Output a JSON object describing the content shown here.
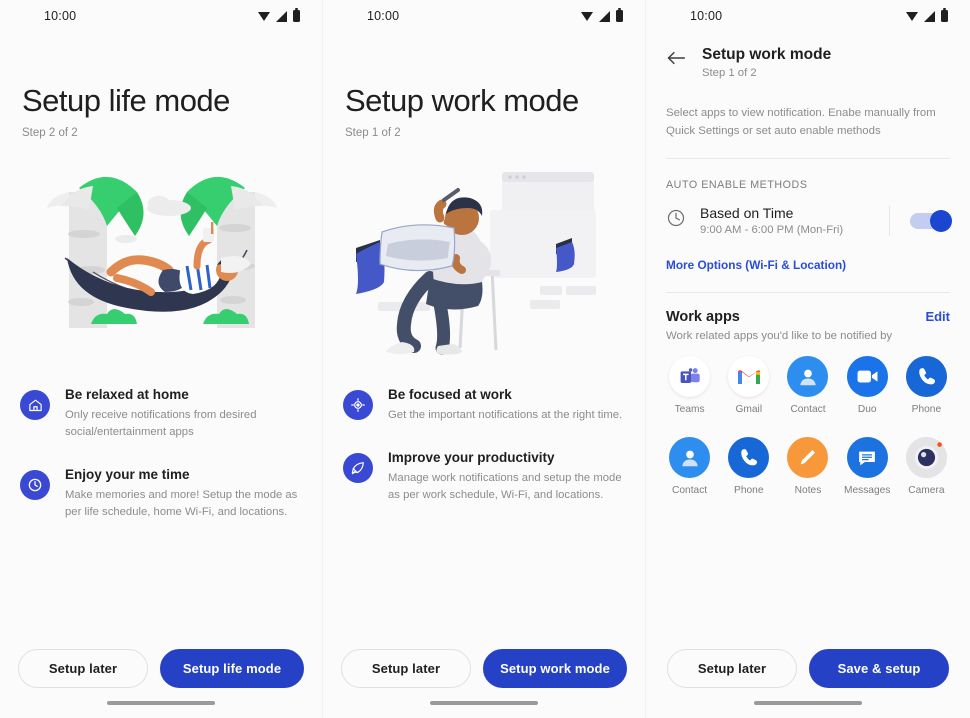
{
  "statusbar": {
    "time": "10:00",
    "icons": [
      "wifi-icon",
      "signal-icon",
      "battery-icon"
    ]
  },
  "colors": {
    "primary": "#2541c6",
    "badge": "#3949d4",
    "link": "#2a4cd7",
    "toggle_on": "#1a46d0",
    "background": "#fbfbfb",
    "text": "#1f1f1f",
    "muted": "#8c8c8c"
  },
  "panel_life": {
    "title": "Setup life mode",
    "step": "Step 2 of 2",
    "illustration": "hammock-relax-illustration",
    "features": [
      {
        "icon": "home-icon",
        "title": "Be relaxed at home",
        "desc": "Only receive notifications from desired social/entertainment apps"
      },
      {
        "icon": "clock-icon",
        "title": "Enjoy your me time",
        "desc": "Make memories and more! Setup the mode as per life schedule, home Wi-Fi, and locations."
      }
    ],
    "secondary_button": "Setup later",
    "primary_button": "Setup life mode"
  },
  "panel_work": {
    "title": "Setup work mode",
    "step": "Step 1 of 2",
    "illustration": "person-working-on-stool-illustration",
    "features": [
      {
        "icon": "target-icon",
        "title": "Be focused at work",
        "desc": "Get the important notifications at the right  time."
      },
      {
        "icon": "rocket-icon",
        "title": "Improve your productivity",
        "desc": "Manage work notifications and setup the mode as per work schedule, Wi-Fi, and locations."
      }
    ],
    "secondary_button": "Setup later",
    "primary_button": "Setup work mode"
  },
  "panel_settings": {
    "back_icon": "back-arrow-icon",
    "title": "Setup work mode",
    "step": "Step 1 of 2",
    "description": "Select apps to view notification. Enabe manually from Quick Settings or set auto enable methods",
    "section_caption": "AUTO ENABLE METHODS",
    "time_rule": {
      "icon": "clock-icon",
      "title": "Based on Time",
      "subtitle": "9:00 AM - 6:00 PM (Mon-Fri)",
      "toggle_state": "on"
    },
    "more_options_link": "More Options (Wi-Fi & Location)",
    "work_apps": {
      "title": "Work apps",
      "edit_label": "Edit",
      "subtitle": "Work related apps you'd like to be notified by",
      "row1": [
        {
          "name": "Teams",
          "icon": "teams-icon"
        },
        {
          "name": "Gmail",
          "icon": "gmail-icon"
        },
        {
          "name": "Contact",
          "icon": "contact-icon"
        },
        {
          "name": "Duo",
          "icon": "duo-icon"
        },
        {
          "name": "Phone",
          "icon": "phone-icon"
        }
      ],
      "row2": [
        {
          "name": "Contact",
          "icon": "contact-icon"
        },
        {
          "name": "Phone",
          "icon": "phone-icon"
        },
        {
          "name": "Notes",
          "icon": "notes-icon"
        },
        {
          "name": "Messages",
          "icon": "messages-icon"
        },
        {
          "name": "Camera",
          "icon": "camera-icon"
        }
      ]
    },
    "secondary_button": "Setup later",
    "primary_button": "Save & setup"
  }
}
